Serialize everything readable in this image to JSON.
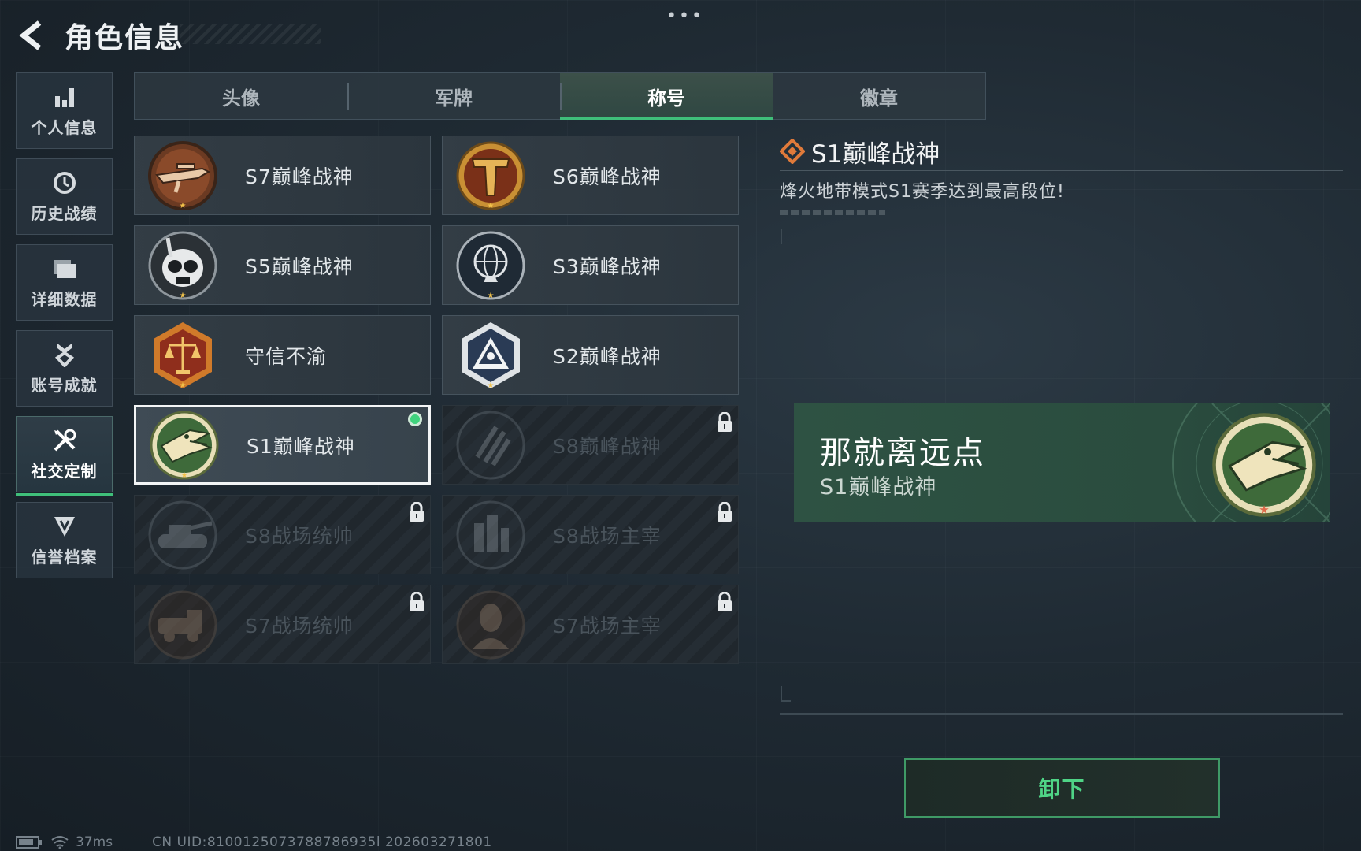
{
  "header": {
    "title": "角色信息",
    "back_icon": "back-arrow-icon",
    "more_icon": "more-dots-icon",
    "more_text": "•••"
  },
  "sidebar": {
    "items": [
      {
        "label": "个人信息",
        "icon": "bar-chart-icon"
      },
      {
        "label": "历史战绩",
        "icon": "history-clock-icon"
      },
      {
        "label": "详细数据",
        "icon": "folder-icon"
      },
      {
        "label": "账号成就",
        "icon": "achievement-medal-icon"
      },
      {
        "label": "社交定制",
        "icon": "tools-icon",
        "active": true
      },
      {
        "label": "信誉档案",
        "icon": "credit-shield-icon"
      }
    ]
  },
  "tabs": [
    {
      "label": "头像"
    },
    {
      "label": "军牌"
    },
    {
      "label": "称号",
      "active": true
    },
    {
      "label": "徽章"
    }
  ],
  "titles": [
    {
      "name": "S7巅峰战神",
      "badge": "sniper-rifle-badge",
      "locked": false
    },
    {
      "name": "S6巅峰战神",
      "badge": "gold-t-shield-badge",
      "locked": false
    },
    {
      "name": "S5巅峰战神",
      "badge": "skull-mask-badge",
      "locked": false
    },
    {
      "name": "S3巅峰战神",
      "badge": "globe-trophy-badge",
      "locked": false
    },
    {
      "name": "守信不渝",
      "badge": "scales-badge",
      "locked": false
    },
    {
      "name": "S2巅峰战神",
      "badge": "eye-triangle-badge",
      "locked": false
    },
    {
      "name": "S1巅峰战神",
      "badge": "crocodile-badge",
      "locked": false,
      "selected": true,
      "equipped": true
    },
    {
      "name": "S8巅峰战神",
      "badge": "claw-badge",
      "locked": true
    },
    {
      "name": "S8战场统帅",
      "badge": "tank-badge",
      "locked": true
    },
    {
      "name": "S8战场主宰",
      "badge": "city-badge",
      "locked": true
    },
    {
      "name": "S7战场统帅",
      "badge": "truck-badge",
      "locked": true
    },
    {
      "name": "S7战场主宰",
      "badge": "soldier-badge",
      "locked": true
    }
  ],
  "detail": {
    "title": "S1巅峰战神",
    "description": "烽火地带模式S1赛季达到最高段位!",
    "icon": "diamond-emblem-icon"
  },
  "preview": {
    "player_name": "那就离远点",
    "title": "S1巅峰战神",
    "badge": "crocodile-badge"
  },
  "action": {
    "unequip_label": "卸下"
  },
  "status_bar": {
    "battery_icon": "battery-icon",
    "wifi_icon": "wifi-icon",
    "ping": "37ms",
    "uid": "CN UID:8100125073788786935l 202603271801"
  },
  "colors": {
    "accent_green": "#3fbf7a",
    "preview_bg": "#2e5243",
    "title_orange": "#e07a3a"
  }
}
